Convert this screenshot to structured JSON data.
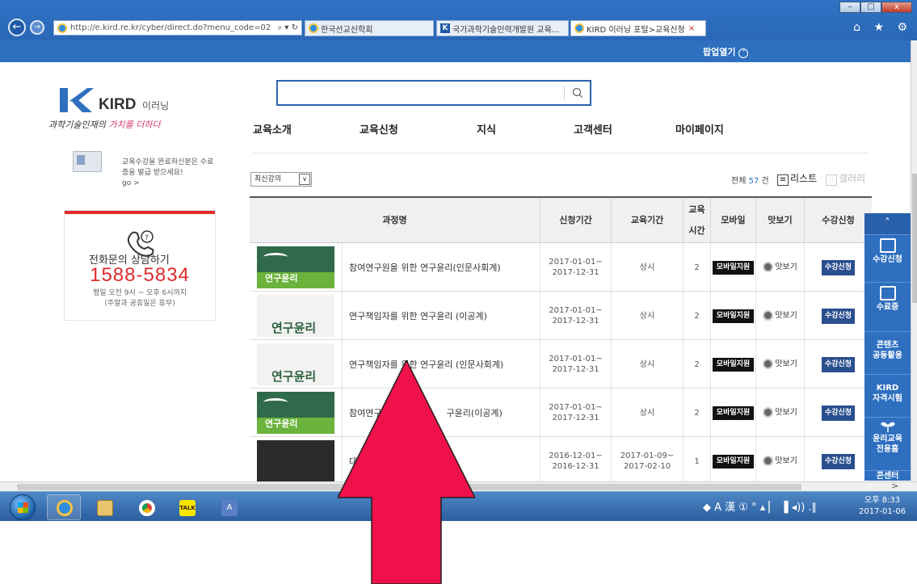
{
  "browser": {
    "url": "http://e.kird.re.kr/cyber/direct.do?menu_code=02",
    "addr_tools": "⌕ ▾ ↻",
    "tabs": [
      {
        "label": "한국선교신학회",
        "icon": "ie-icon"
      },
      {
        "label": "국가과학기술인력개발원 교육...",
        "icon": "kird-icon"
      },
      {
        "label": "KIRD 이러닝 포털>교육신청",
        "icon": "ie-icon"
      }
    ],
    "tab_close": "×",
    "back": "←",
    "forward": "→",
    "right_icons": "⌂ ★ ⚙",
    "win_min": "–",
    "win_max": "□",
    "win_close": "x"
  },
  "sitebar": {
    "popup_label": "팝업열기",
    "popup_icon": "˅"
  },
  "logo": {
    "brand": "KIRD",
    "sub": "이러닝",
    "slogan_1": "과학기술인재의 ",
    "slogan_2": "가치를 더하다"
  },
  "certificate": {
    "text": "교육수강을 완료하신분은 수료증을 발급 받으세요!",
    "go": "go >"
  },
  "call": {
    "title": "전화문의    상담하기",
    "number": "1588-5834",
    "hours_1": "평일 오전 9시 ~ 오후 6시까지",
    "hours_2": "(주말과 공휴일은 휴무)"
  },
  "search": {
    "value": ""
  },
  "gnb": [
    "교육소개",
    "교육신청",
    "지식",
    "고객센터",
    "마이페이지"
  ],
  "list_controls": {
    "sort_selected": "최신강의",
    "sort_caret": "∨",
    "total_prefix": "전체",
    "total_count": "57",
    "total_suffix": "건",
    "view_list": "리스트",
    "view_gallery": "갤러리"
  },
  "table": {
    "headers": [
      "과정명",
      "신청기간",
      "교육기간",
      "교육\n시간",
      "모바일",
      "맛보기",
      "수강신청"
    ],
    "rows": [
      {
        "thumb": "연구윤리",
        "title": "참여연구원을 위한 연구윤리(인문사회계)",
        "apply_from": "2017-01-01~",
        "apply_to": "2017-12-31",
        "period_1": "상시",
        "period_2": "",
        "hours": "2",
        "mobile": "모바일지원",
        "preview": "맛보기",
        "apply": "수강신청",
        "live": ""
      },
      {
        "thumb": "연구윤리",
        "title": "연구책임자를 위한 연구윤리 (이공계)",
        "apply_from": "2017-01-01~",
        "apply_to": "2017-12-31",
        "period_1": "상시",
        "period_2": "",
        "hours": "2",
        "mobile": "모바일지원",
        "preview": "맛보기",
        "apply": "수강신청",
        "live": ""
      },
      {
        "thumb": "연구윤리",
        "title": "연구책임자를 위한 연구윤리 (인문사회계)",
        "apply_from": "2017-01-01~",
        "apply_to": "2017-12-31",
        "period_1": "상시",
        "period_2": "",
        "hours": "2",
        "mobile": "모바일지원",
        "preview": "맛보기",
        "apply": "수강신청",
        "live": ""
      },
      {
        "thumb": "연구윤리",
        "title": "참여연구원                    구윤리(이공계)",
        "apply_from": "2017-01-01~",
        "apply_to": "2017-12-31",
        "period_1": "상시",
        "period_2": "",
        "hours": "2",
        "mobile": "모바일지원",
        "preview": "맛보기",
        "apply": "수강신청",
        "live": ""
      },
      {
        "thumb": "",
        "title": "대",
        "apply_from": "2016-12-01~",
        "apply_to": "2016-12-31",
        "period_1": "2017-01-09~",
        "period_2": "2017-02-10",
        "hours": "1",
        "mobile": "모바일지원",
        "preview": "맛보기",
        "apply": "수강신청",
        "live": "강"
      }
    ]
  },
  "quick_menu": {
    "top": "˄",
    "items": [
      "수강신청",
      "수료증",
      "콘텐츠\n공동활용",
      "KIRD\n자격시험",
      "윤리교육\n전용홈",
      "콘센터"
    ]
  },
  "scroll": {
    "left": "<",
    "right": ">"
  },
  "taskbar": {
    "tray": "◆ A 漢 ① ° ▴ ▏ ▐ ◂)) .∥",
    "time": "오후 8:33",
    "date": "2017-01-06"
  },
  "colors": {
    "brand_blue": "#2e6fc0",
    "call_red": "#e02b2b",
    "arrow": "#f0104a"
  }
}
